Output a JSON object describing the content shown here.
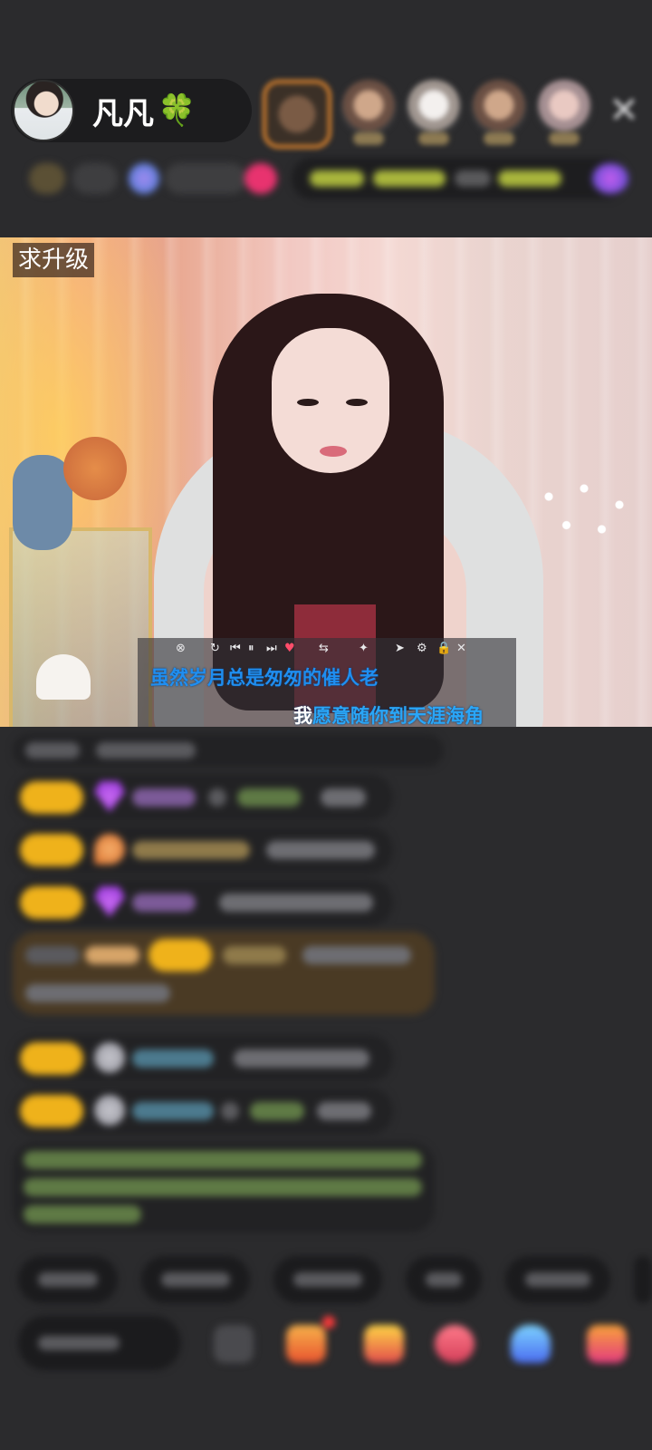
{
  "host": {
    "name": "凡凡",
    "name_emoji": "🍀"
  },
  "top_bar": {
    "close_icon": "close-icon",
    "viewer_count_visible": 5
  },
  "stream": {
    "level_tag": "求升级",
    "lyrics": {
      "line1": "虽然岁月总是匆匆的催人老",
      "line2_highlight": "我",
      "line2_rest": "愿意随你到天涯海角"
    },
    "player_controls": [
      "close-icon",
      "loop-icon",
      "prev-icon",
      "pause-icon",
      "next-icon",
      "heart-icon",
      "arrows-icon",
      "settings-icon",
      "lock-icon",
      "close-icon"
    ]
  },
  "colors": {
    "background": "#2b2b2d",
    "level_badge": "#efb21b",
    "lyric_blue": "#1f8ef0"
  }
}
